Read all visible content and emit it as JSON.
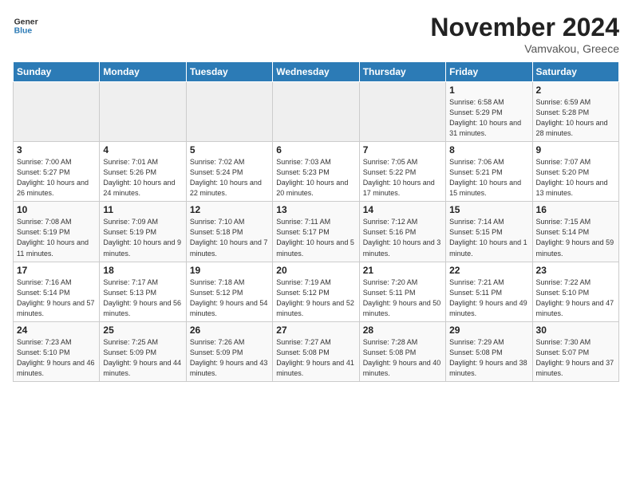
{
  "header": {
    "logo_general": "General",
    "logo_blue": "Blue",
    "month_title": "November 2024",
    "location": "Vamvakou, Greece"
  },
  "weekdays": [
    "Sunday",
    "Monday",
    "Tuesday",
    "Wednesday",
    "Thursday",
    "Friday",
    "Saturday"
  ],
  "weeks": [
    [
      {
        "day": "",
        "info": ""
      },
      {
        "day": "",
        "info": ""
      },
      {
        "day": "",
        "info": ""
      },
      {
        "day": "",
        "info": ""
      },
      {
        "day": "",
        "info": ""
      },
      {
        "day": "1",
        "info": "Sunrise: 6:58 AM\nSunset: 5:29 PM\nDaylight: 10 hours and 31 minutes."
      },
      {
        "day": "2",
        "info": "Sunrise: 6:59 AM\nSunset: 5:28 PM\nDaylight: 10 hours and 28 minutes."
      }
    ],
    [
      {
        "day": "3",
        "info": "Sunrise: 7:00 AM\nSunset: 5:27 PM\nDaylight: 10 hours and 26 minutes."
      },
      {
        "day": "4",
        "info": "Sunrise: 7:01 AM\nSunset: 5:26 PM\nDaylight: 10 hours and 24 minutes."
      },
      {
        "day": "5",
        "info": "Sunrise: 7:02 AM\nSunset: 5:24 PM\nDaylight: 10 hours and 22 minutes."
      },
      {
        "day": "6",
        "info": "Sunrise: 7:03 AM\nSunset: 5:23 PM\nDaylight: 10 hours and 20 minutes."
      },
      {
        "day": "7",
        "info": "Sunrise: 7:05 AM\nSunset: 5:22 PM\nDaylight: 10 hours and 17 minutes."
      },
      {
        "day": "8",
        "info": "Sunrise: 7:06 AM\nSunset: 5:21 PM\nDaylight: 10 hours and 15 minutes."
      },
      {
        "day": "9",
        "info": "Sunrise: 7:07 AM\nSunset: 5:20 PM\nDaylight: 10 hours and 13 minutes."
      }
    ],
    [
      {
        "day": "10",
        "info": "Sunrise: 7:08 AM\nSunset: 5:19 PM\nDaylight: 10 hours and 11 minutes."
      },
      {
        "day": "11",
        "info": "Sunrise: 7:09 AM\nSunset: 5:19 PM\nDaylight: 10 hours and 9 minutes."
      },
      {
        "day": "12",
        "info": "Sunrise: 7:10 AM\nSunset: 5:18 PM\nDaylight: 10 hours and 7 minutes."
      },
      {
        "day": "13",
        "info": "Sunrise: 7:11 AM\nSunset: 5:17 PM\nDaylight: 10 hours and 5 minutes."
      },
      {
        "day": "14",
        "info": "Sunrise: 7:12 AM\nSunset: 5:16 PM\nDaylight: 10 hours and 3 minutes."
      },
      {
        "day": "15",
        "info": "Sunrise: 7:14 AM\nSunset: 5:15 PM\nDaylight: 10 hours and 1 minute."
      },
      {
        "day": "16",
        "info": "Sunrise: 7:15 AM\nSunset: 5:14 PM\nDaylight: 9 hours and 59 minutes."
      }
    ],
    [
      {
        "day": "17",
        "info": "Sunrise: 7:16 AM\nSunset: 5:14 PM\nDaylight: 9 hours and 57 minutes."
      },
      {
        "day": "18",
        "info": "Sunrise: 7:17 AM\nSunset: 5:13 PM\nDaylight: 9 hours and 56 minutes."
      },
      {
        "day": "19",
        "info": "Sunrise: 7:18 AM\nSunset: 5:12 PM\nDaylight: 9 hours and 54 minutes."
      },
      {
        "day": "20",
        "info": "Sunrise: 7:19 AM\nSunset: 5:12 PM\nDaylight: 9 hours and 52 minutes."
      },
      {
        "day": "21",
        "info": "Sunrise: 7:20 AM\nSunset: 5:11 PM\nDaylight: 9 hours and 50 minutes."
      },
      {
        "day": "22",
        "info": "Sunrise: 7:21 AM\nSunset: 5:11 PM\nDaylight: 9 hours and 49 minutes."
      },
      {
        "day": "23",
        "info": "Sunrise: 7:22 AM\nSunset: 5:10 PM\nDaylight: 9 hours and 47 minutes."
      }
    ],
    [
      {
        "day": "24",
        "info": "Sunrise: 7:23 AM\nSunset: 5:10 PM\nDaylight: 9 hours and 46 minutes."
      },
      {
        "day": "25",
        "info": "Sunrise: 7:25 AM\nSunset: 5:09 PM\nDaylight: 9 hours and 44 minutes."
      },
      {
        "day": "26",
        "info": "Sunrise: 7:26 AM\nSunset: 5:09 PM\nDaylight: 9 hours and 43 minutes."
      },
      {
        "day": "27",
        "info": "Sunrise: 7:27 AM\nSunset: 5:08 PM\nDaylight: 9 hours and 41 minutes."
      },
      {
        "day": "28",
        "info": "Sunrise: 7:28 AM\nSunset: 5:08 PM\nDaylight: 9 hours and 40 minutes."
      },
      {
        "day": "29",
        "info": "Sunrise: 7:29 AM\nSunset: 5:08 PM\nDaylight: 9 hours and 38 minutes."
      },
      {
        "day": "30",
        "info": "Sunrise: 7:30 AM\nSunset: 5:07 PM\nDaylight: 9 hours and 37 minutes."
      }
    ]
  ]
}
